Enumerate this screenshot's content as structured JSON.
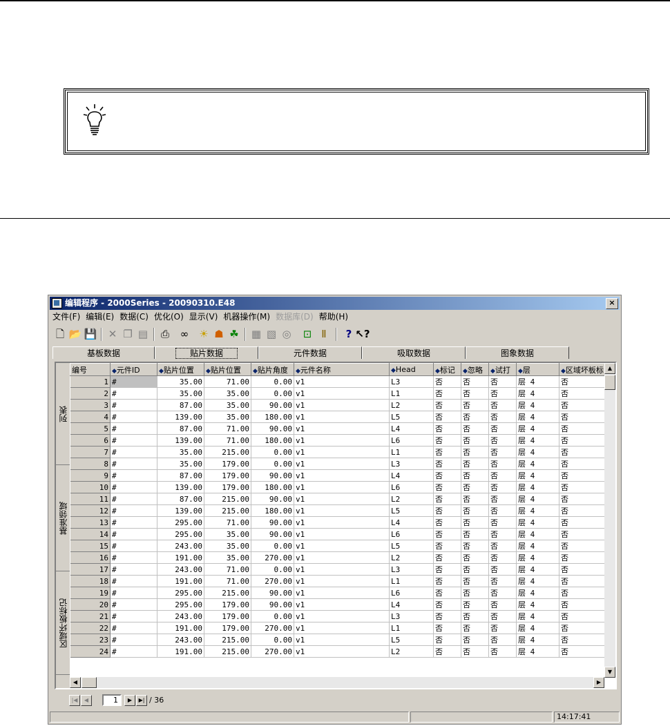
{
  "window": {
    "title": "编辑程序 - 2000Series - 20090310.E48",
    "close_label": "×"
  },
  "menu": [
    {
      "label": "文件(F)",
      "enabled": true
    },
    {
      "label": "编辑(E)",
      "enabled": true
    },
    {
      "label": "数据(C)",
      "enabled": true
    },
    {
      "label": "优化(O)",
      "enabled": true
    },
    {
      "label": "显示(V)",
      "enabled": true
    },
    {
      "label": "机器操作(M)",
      "enabled": true
    },
    {
      "label": "数据库(D)",
      "enabled": false
    },
    {
      "label": "帮助(H)",
      "enabled": true
    }
  ],
  "toolbar_icons": [
    "new-file-icon",
    "open-folder-icon",
    "save-icon",
    "cut-icon",
    "copy-icon",
    "paste-icon",
    "print-icon",
    "find-icon",
    "lightbulb-icon",
    "optimize-icon",
    "nozzle-icon",
    "board-icon",
    "feeder-icon",
    "part-icon",
    "machine-icon",
    "column-icon",
    "help-icon",
    "context-help-icon"
  ],
  "tabs": [
    {
      "label": "基板数据",
      "active": false
    },
    {
      "label": "贴片数据",
      "active": true
    },
    {
      "label": "元件数据",
      "active": false
    },
    {
      "label": "吸取数据",
      "active": false
    },
    {
      "label": "图象数据",
      "active": false
    }
  ],
  "sidebar": [
    "列表",
    "基准领域",
    "区域坏板标记"
  ],
  "grid": {
    "columns": [
      "编号",
      "元件ID",
      "贴片位置",
      "贴片位置",
      "贴片角度",
      "元件名称",
      "Head",
      "标记",
      "忽略",
      "试打",
      "层",
      "区域坏板标"
    ],
    "rows": [
      [
        "1",
        "#",
        "35.00",
        "71.00",
        "0.00",
        "v1",
        "L3",
        "否",
        "否",
        "否",
        "层 4",
        "否"
      ],
      [
        "2",
        "#",
        "35.00",
        "35.00",
        "0.00",
        "v1",
        "L1",
        "否",
        "否",
        "否",
        "层 4",
        "否"
      ],
      [
        "3",
        "#",
        "87.00",
        "35.00",
        "90.00",
        "v1",
        "L2",
        "否",
        "否",
        "否",
        "层 4",
        "否"
      ],
      [
        "4",
        "#",
        "139.00",
        "35.00",
        "180.00",
        "v1",
        "L5",
        "否",
        "否",
        "否",
        "层 4",
        "否"
      ],
      [
        "5",
        "#",
        "87.00",
        "71.00",
        "90.00",
        "v1",
        "L4",
        "否",
        "否",
        "否",
        "层 4",
        "否"
      ],
      [
        "6",
        "#",
        "139.00",
        "71.00",
        "180.00",
        "v1",
        "L6",
        "否",
        "否",
        "否",
        "层 4",
        "否"
      ],
      [
        "7",
        "#",
        "35.00",
        "215.00",
        "0.00",
        "v1",
        "L1",
        "否",
        "否",
        "否",
        "层 4",
        "否"
      ],
      [
        "8",
        "#",
        "35.00",
        "179.00",
        "0.00",
        "v1",
        "L3",
        "否",
        "否",
        "否",
        "层 4",
        "否"
      ],
      [
        "9",
        "#",
        "87.00",
        "179.00",
        "90.00",
        "v1",
        "L4",
        "否",
        "否",
        "否",
        "层 4",
        "否"
      ],
      [
        "10",
        "#",
        "139.00",
        "179.00",
        "180.00",
        "v1",
        "L6",
        "否",
        "否",
        "否",
        "层 4",
        "否"
      ],
      [
        "11",
        "#",
        "87.00",
        "215.00",
        "90.00",
        "v1",
        "L2",
        "否",
        "否",
        "否",
        "层 4",
        "否"
      ],
      [
        "12",
        "#",
        "139.00",
        "215.00",
        "180.00",
        "v1",
        "L5",
        "否",
        "否",
        "否",
        "层 4",
        "否"
      ],
      [
        "13",
        "#",
        "295.00",
        "71.00",
        "90.00",
        "v1",
        "L4",
        "否",
        "否",
        "否",
        "层 4",
        "否"
      ],
      [
        "14",
        "#",
        "295.00",
        "35.00",
        "90.00",
        "v1",
        "L6",
        "否",
        "否",
        "否",
        "层 4",
        "否"
      ],
      [
        "15",
        "#",
        "243.00",
        "35.00",
        "0.00",
        "v1",
        "L5",
        "否",
        "否",
        "否",
        "层 4",
        "否"
      ],
      [
        "16",
        "#",
        "191.00",
        "35.00",
        "270.00",
        "v1",
        "L2",
        "否",
        "否",
        "否",
        "层 4",
        "否"
      ],
      [
        "17",
        "#",
        "243.00",
        "71.00",
        "0.00",
        "v1",
        "L3",
        "否",
        "否",
        "否",
        "层 4",
        "否"
      ],
      [
        "18",
        "#",
        "191.00",
        "71.00",
        "270.00",
        "v1",
        "L1",
        "否",
        "否",
        "否",
        "层 4",
        "否"
      ],
      [
        "19",
        "#",
        "295.00",
        "215.00",
        "90.00",
        "v1",
        "L6",
        "否",
        "否",
        "否",
        "层 4",
        "否"
      ],
      [
        "20",
        "#",
        "295.00",
        "179.00",
        "90.00",
        "v1",
        "L4",
        "否",
        "否",
        "否",
        "层 4",
        "否"
      ],
      [
        "21",
        "#",
        "243.00",
        "179.00",
        "0.00",
        "v1",
        "L3",
        "否",
        "否",
        "否",
        "层 4",
        "否"
      ],
      [
        "22",
        "#",
        "191.00",
        "179.00",
        "270.00",
        "v1",
        "L1",
        "否",
        "否",
        "否",
        "层 4",
        "否"
      ],
      [
        "23",
        "#",
        "243.00",
        "215.00",
        "0.00",
        "v1",
        "L5",
        "否",
        "否",
        "否",
        "层 4",
        "否"
      ],
      [
        "24",
        "#",
        "191.00",
        "215.00",
        "270.00",
        "v1",
        "L2",
        "否",
        "否",
        "否",
        "层 4",
        "否"
      ]
    ]
  },
  "pager": {
    "current": "1",
    "total": "/ 36"
  },
  "status": {
    "time": "14:17:41"
  }
}
